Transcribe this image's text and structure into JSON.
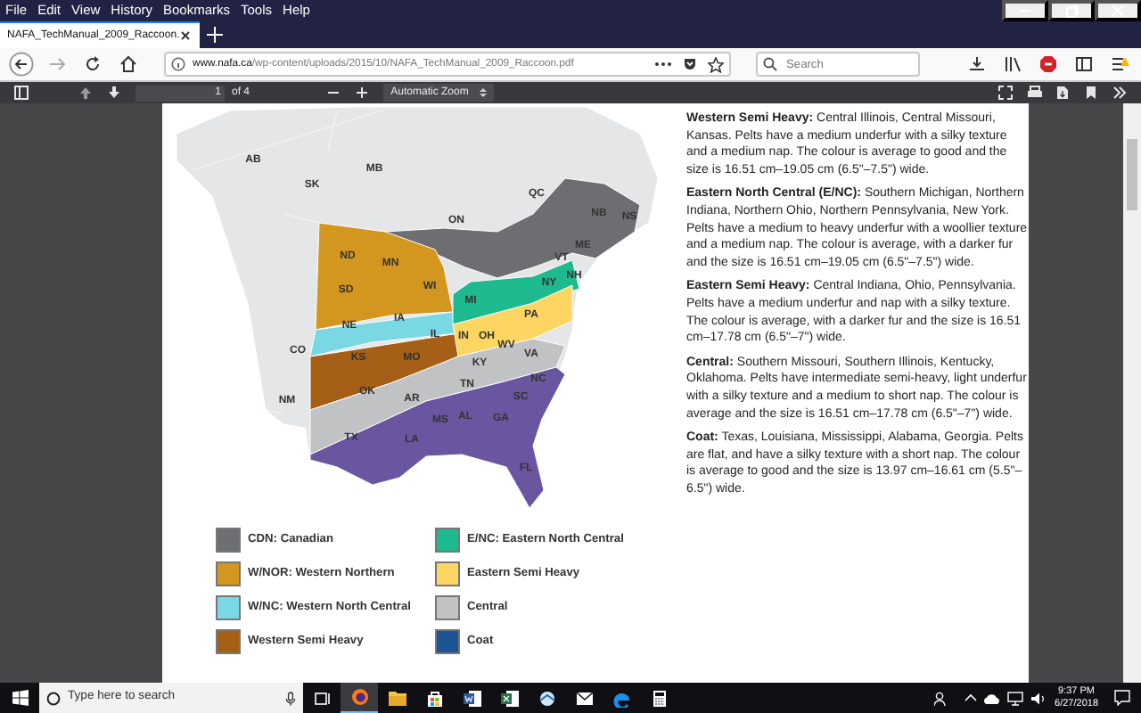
{
  "menu_bar": [
    "File",
    "Edit",
    "View",
    "History",
    "Bookmarks",
    "Tools",
    "Help"
  ],
  "tab": {
    "title": "NAFA_TechManual_2009_Raccoon."
  },
  "address_bar": {
    "host": "www.nafa.ca",
    "path": "/wp-content/uploads/2015/10/NAFA_TechManual_2009_Raccoon.pdf"
  },
  "search": {
    "placeholder": "Search"
  },
  "pdf_toolbar": {
    "page": "1",
    "page_count": "of 4",
    "zoom": "Automatic Zoom"
  },
  "map": {
    "labels": [
      "AB",
      "SK",
      "MB",
      "QC",
      "ON",
      "NB",
      "NS",
      "ND",
      "MN",
      "VT",
      "ME",
      "SD",
      "WI",
      "MI",
      "NY",
      "NH",
      "NE",
      "IA",
      "IL",
      "IN",
      "OH",
      "PA",
      "CO",
      "KS",
      "MO",
      "KY",
      "WV",
      "VA",
      "NM",
      "OK",
      "AR",
      "TN",
      "SC",
      "NC",
      "TX",
      "LA",
      "MS",
      "AL",
      "GA",
      "FL"
    ]
  },
  "legend": [
    {
      "label": "CDN: Canadian",
      "color": "#6d6e71"
    },
    {
      "label": "E/NC: Eastern North Central",
      "color": "#1fb98f"
    },
    {
      "label": "W/NOR: Western Northern",
      "color": "#d3961f"
    },
    {
      "label": "Eastern Semi Heavy",
      "color": "#fcd562"
    },
    {
      "label": "W/NC: Western North Central",
      "color": "#7ad8e4"
    },
    {
      "label": "Central",
      "color": "#c1c2c4"
    },
    {
      "label": "Western Semi Heavy",
      "color": "#a65f17"
    },
    {
      "label": "Coat",
      "color": "#1d5493"
    }
  ],
  "paragraphs": [
    "**Western Semi Heavy:** Central Illinois, Central Missouri, Kansas. Pelts have a medium underfur with a silky texture and a medium nap. The colour is average to good and the size is 16.51 cm–19.05 cm (6.5\"–7.5\") wide.",
    "**Eastern North Central (E/NC):** Southern Michigan, Northern Indiana, Northern Ohio, Northern Pennsylvania, New York. Pelts have a medium to heavy underfur with a  woollier texture and a medium nap. The colour is average, with a darker fur and the size is 16.51 cm–19.05 cm (6.5\"–7.5\") wide.",
    "**Eastern Semi Heavy:** Central Indiana, Ohio, Pennsylvania. Pelts have a medium underfur and nap with a silky texture. The colour is average, with a darker fur and the size is 16.51 cm–17.78 cm (6.5\"–7\") wide.",
    "**Central:** Southern Missouri, Southern Illinois, Kentucky, Oklahoma. Pelts have intermediate semi-heavy, light underfur with a silky texture and a medium to short nap. The colour is average and the size is 16.51 cm–17.78 cm (6.5\"–7\") wide.",
    "**Coat:** Texas, Louisiana, Mississippi, Alabama, Georgia. Pelts are flat, and have a silky texture with a short nap. The colour is average to good and the size is 13.97 cm–16.61 cm (5.5\"–6.5\") wide."
  ],
  "taskbar": {
    "search_placeholder": "Type here to search",
    "time": "9:37 PM",
    "date": "6/27/2018"
  }
}
